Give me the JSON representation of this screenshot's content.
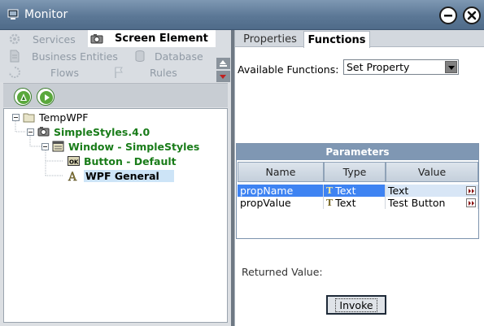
{
  "window": {
    "title": "Monitor",
    "icons": {
      "app": "monitor-icon",
      "minimize": "minimize-icon",
      "close": "close-icon"
    }
  },
  "nav": {
    "items": [
      {
        "label": "Services",
        "icon": "gear-icon"
      },
      {
        "label": "Screen Element",
        "icon": "camera-icon",
        "active": true
      },
      {
        "label": "Business Entities",
        "icon": "document-icon"
      },
      {
        "label": "Database",
        "icon": "database-icon"
      },
      {
        "label": "Flows",
        "icon": "flow-icon"
      },
      {
        "label": "Rules",
        "icon": "flag-icon"
      }
    ]
  },
  "toolbar": {
    "buttons": [
      "highlight-icon",
      "play-icon"
    ]
  },
  "tree": {
    "nodes": [
      {
        "label": "TempWPF",
        "icon": "folder-icon",
        "expanded": true
      },
      {
        "label": "SimpleStyles.4.0",
        "icon": "camera-icon",
        "expanded": true
      },
      {
        "label": "Window - SimpleStyles",
        "icon": "window-icon",
        "expanded": true
      },
      {
        "label": "Button - Default",
        "icon": "ok-button-icon"
      },
      {
        "label": "WPF General",
        "icon": "text-element-icon",
        "selected": true
      }
    ]
  },
  "tabs": [
    {
      "label": "Properties",
      "active": false
    },
    {
      "label": "Functions",
      "active": true
    }
  ],
  "functions": {
    "available_label": "Available Functions:",
    "selected_function": "Set Property"
  },
  "parameters": {
    "title": "Parameters",
    "columns": [
      "Name",
      "Type",
      "Value"
    ],
    "rows": [
      {
        "name": "propName",
        "type": "Text",
        "value": "Text",
        "selected": true
      },
      {
        "name": "propValue",
        "type": "Text",
        "value": "Test Button",
        "selected": false
      }
    ]
  },
  "returned_value_label": "Returned Value:",
  "invoke_label": "Invoke",
  "colors": {
    "title_bar": "#5c7896",
    "params_header": "#7f97b3",
    "selection": "#3e83f2",
    "tree_green": "#197c19"
  }
}
